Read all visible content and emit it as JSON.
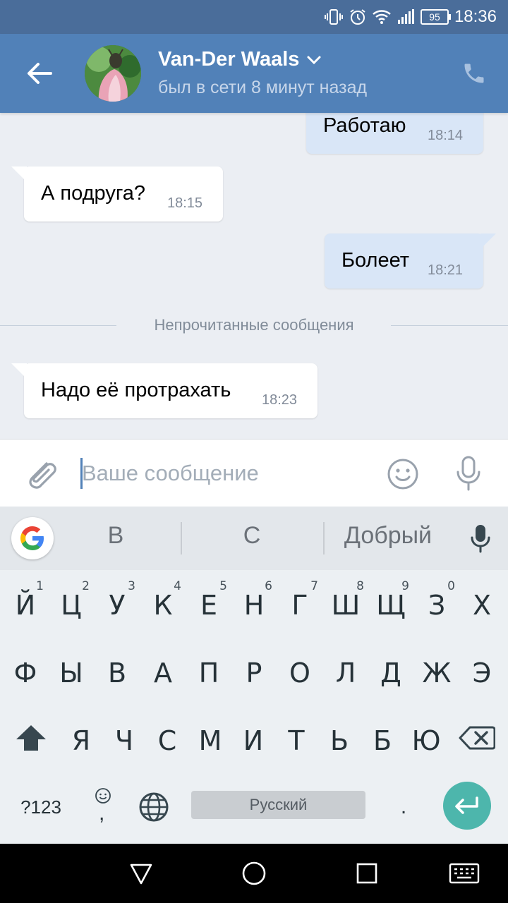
{
  "status_bar": {
    "battery": "95",
    "time": "18:36",
    "icons": [
      "vibrate-icon",
      "alarm-icon",
      "wifi-icon",
      "signal-icon",
      "battery-icon"
    ]
  },
  "header": {
    "back_icon": "arrow-left-icon",
    "contact_name": "Van-Der Waals",
    "status": "был в сети 8 минут назад",
    "call_icon": "phone-icon",
    "accent_color": "#5181b8"
  },
  "messages": [
    {
      "direction": "out",
      "text": "Работаю",
      "time": "18:14"
    },
    {
      "direction": "in",
      "text": "А подруга?",
      "time": "18:15"
    },
    {
      "direction": "out",
      "text": "Болеет",
      "time": "18:21"
    },
    {
      "direction": "in",
      "text": "Надо её протрахать",
      "time": "18:23"
    }
  ],
  "unread_divider": "Непрочитанные сообщения",
  "composer": {
    "placeholder": "Ваше сообщение",
    "value": "",
    "icons": [
      "paperclip-icon",
      "smiley-icon",
      "microphone-icon"
    ]
  },
  "keyboard": {
    "suggestions": [
      "В",
      "С",
      "Добрый"
    ],
    "rows": [
      [
        "Й",
        "Ц",
        "У",
        "К",
        "Е",
        "Н",
        "Г",
        "Ш",
        "Щ",
        "З",
        "Х"
      ],
      [
        "Ф",
        "Ы",
        "В",
        "А",
        "П",
        "Р",
        "О",
        "Л",
        "Д",
        "Ж",
        "Э"
      ],
      [
        "Я",
        "Ч",
        "С",
        "М",
        "И",
        "Т",
        "Ь",
        "Б",
        "Ю"
      ]
    ],
    "number_hints": [
      "1",
      "2",
      "3",
      "4",
      "5",
      "6",
      "7",
      "8",
      "9",
      "0"
    ],
    "num_key": "?123",
    "comma": ",",
    "space_label": "Русский",
    "period": ".",
    "enter_color": "#4db6ac"
  },
  "nav_bar": {
    "icons": [
      "back-triangle-icon",
      "home-circle-icon",
      "recents-square-icon",
      "keyboard-icon"
    ]
  }
}
